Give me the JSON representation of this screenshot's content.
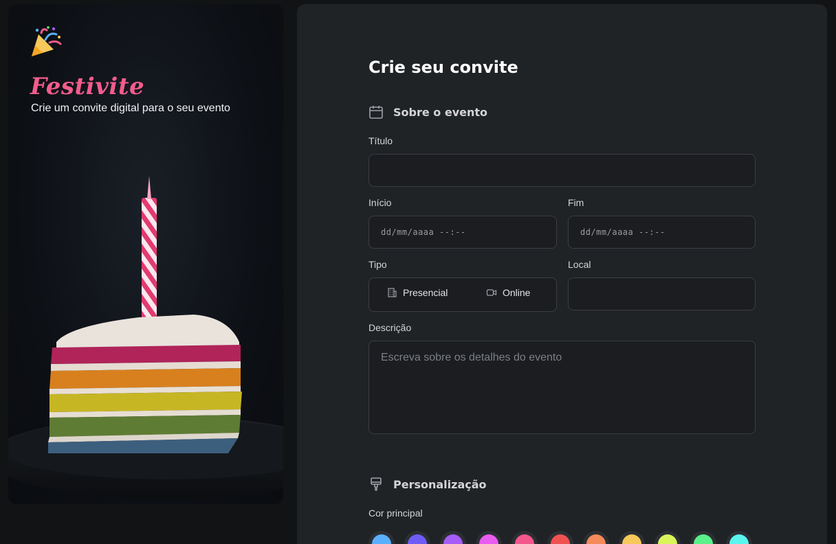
{
  "app": {
    "brand": "Festivite",
    "tagline": "Crie um convite digital para o seu evento"
  },
  "form": {
    "title": "Crie seu convite",
    "section_event": "Sobre o evento",
    "titulo_label": "Título",
    "inicio_label": "Início",
    "inicio_value": "dd/mm/aaaa --:--",
    "fim_label": "Fim",
    "fim_value": "dd/mm/aaaa --:--",
    "tipo_label": "Tipo",
    "tipo_options": [
      "Presencial",
      "Online"
    ],
    "local_label": "Local",
    "descricao_label": "Descrição",
    "descricao_placeholder": "Escreva sobre os detalhes do evento",
    "section_custom": "Personalização",
    "cor_label": "Cor principal",
    "colors": [
      "#5ab0ff",
      "#6f5cf6",
      "#a65cf6",
      "#e95cf0",
      "#f3578c",
      "#f05252",
      "#f58a5a",
      "#f7c85a",
      "#d9f55a",
      "#5af08a",
      "#5af5ee"
    ]
  },
  "icons": {
    "logo": "party-popper-icon",
    "calendar": "calendar-icon",
    "brush": "paintbrush-icon",
    "building": "building-icon",
    "video": "video-icon"
  }
}
